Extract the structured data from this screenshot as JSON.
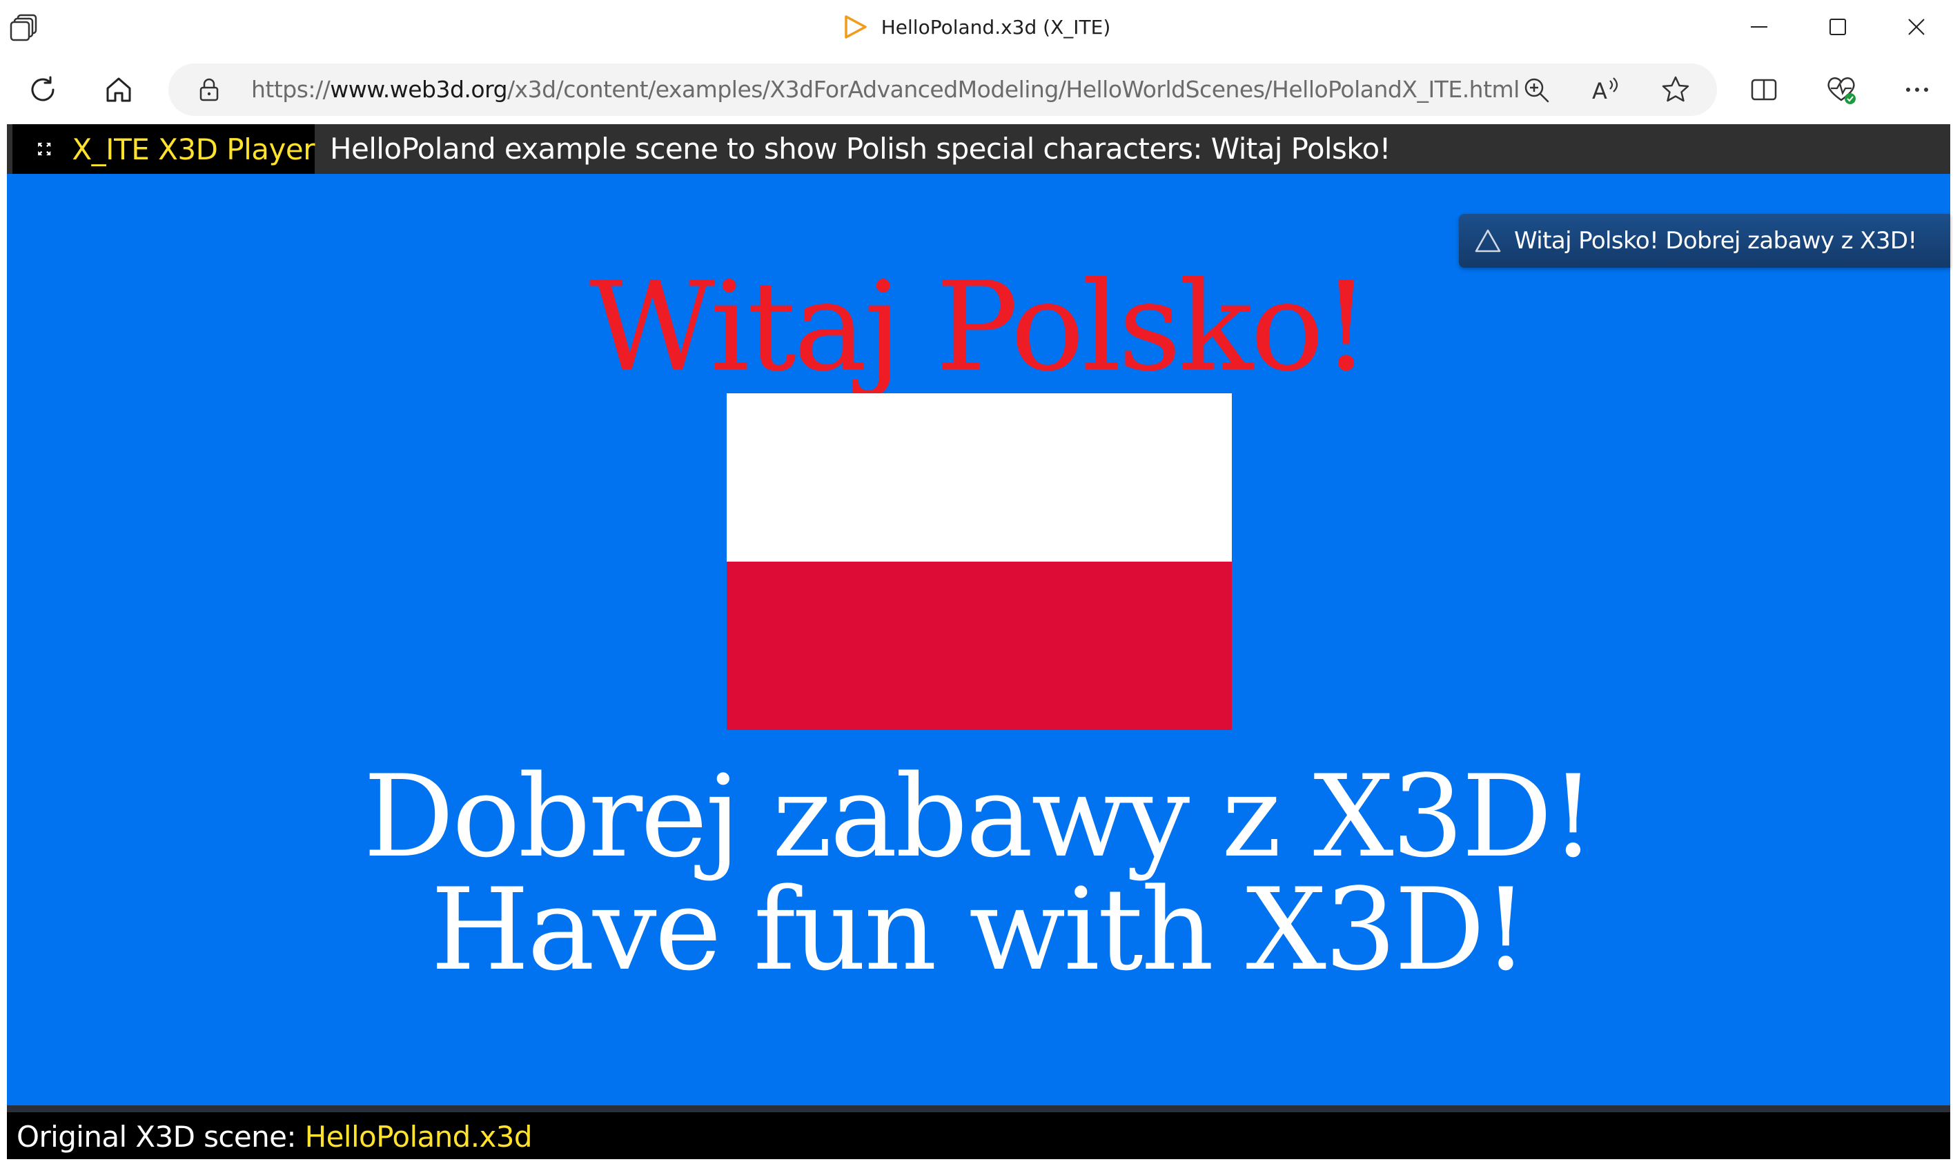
{
  "window": {
    "title": "HelloPoland.x3d (X_ITE)",
    "minimize_icon": "minimize-icon",
    "maximize_icon": "maximize-icon",
    "close_icon": "close-icon"
  },
  "toolbar": {
    "url_scheme": "https://",
    "url_host": "www.web3d.org",
    "url_path": "/x3d/content/examples/X3dForAdvancedModeling/HelloWorldScenes/HelloPolandX_ITE.html",
    "icons": [
      "refresh-icon",
      "home-icon",
      "lock-icon",
      "zoom-icon",
      "read-aloud-icon",
      "favorite-star-icon",
      "split-screen-icon",
      "browser-essentials-icon",
      "more-icon"
    ]
  },
  "player": {
    "brand": "X_ITE X3D Player",
    "scene_title": "HelloPoland example scene to show Polish special characters: Witaj Polsko!",
    "notice": "Witaj Polsko! Dobrej zabawy z X3D!",
    "colors": {
      "background": "#0173f0",
      "title_red": "#ee1c25",
      "flag_white": "#ffffff",
      "flag_red": "#dc0c37",
      "brand_yellow": "#ffe22b"
    }
  },
  "scene": {
    "line1": "Witaj Polsko!",
    "line2": "Dobrej zabawy z X3D!",
    "line3": "Have fun with X3D!"
  },
  "footer": {
    "label": "Original X3D scene: ",
    "link": "HelloPoland.x3d"
  }
}
